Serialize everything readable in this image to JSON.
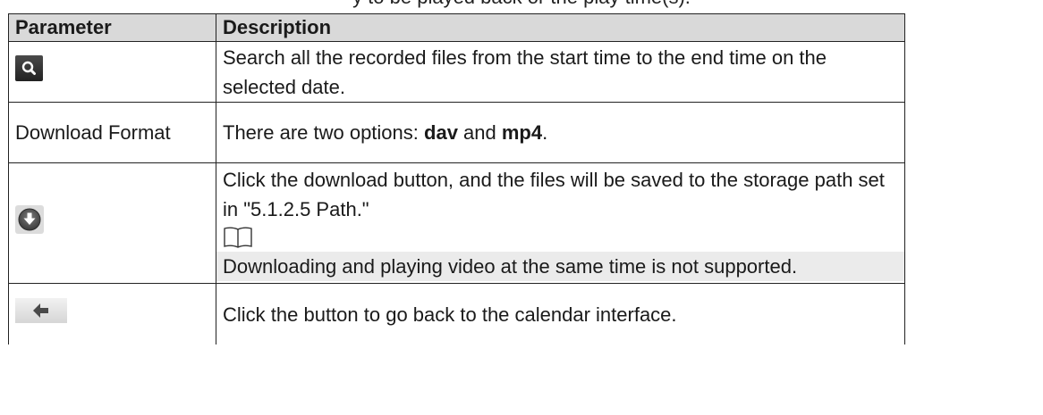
{
  "caption_partial": "y to be played back or the play time(s).",
  "table": {
    "header": {
      "parameter": "Parameter",
      "description": "Description"
    },
    "rows": [
      {
        "parameter_icon": "search-icon",
        "description": "Search all the recorded files from the start time to the end time on the selected date."
      },
      {
        "parameter": "Download Format",
        "description_prefix": "There are two options: ",
        "option1": "dav",
        "description_mid": " and ",
        "option2": "mp4",
        "description_suffix": "."
      },
      {
        "parameter_icon": "download-icon",
        "description": "Click the download button, and the files will be saved to the storage path set in \"5.1.2.5 Path.\"",
        "note_icon": "book-note-icon",
        "note": "Downloading and playing video at the same time is not supported."
      },
      {
        "parameter_icon": "back-arrow-icon",
        "description": "Click the button to go back to the calendar interface."
      }
    ]
  },
  "colors": {
    "header_bg": "#d9d9d9",
    "note_bg": "#ebebeb",
    "border": "#222222"
  }
}
